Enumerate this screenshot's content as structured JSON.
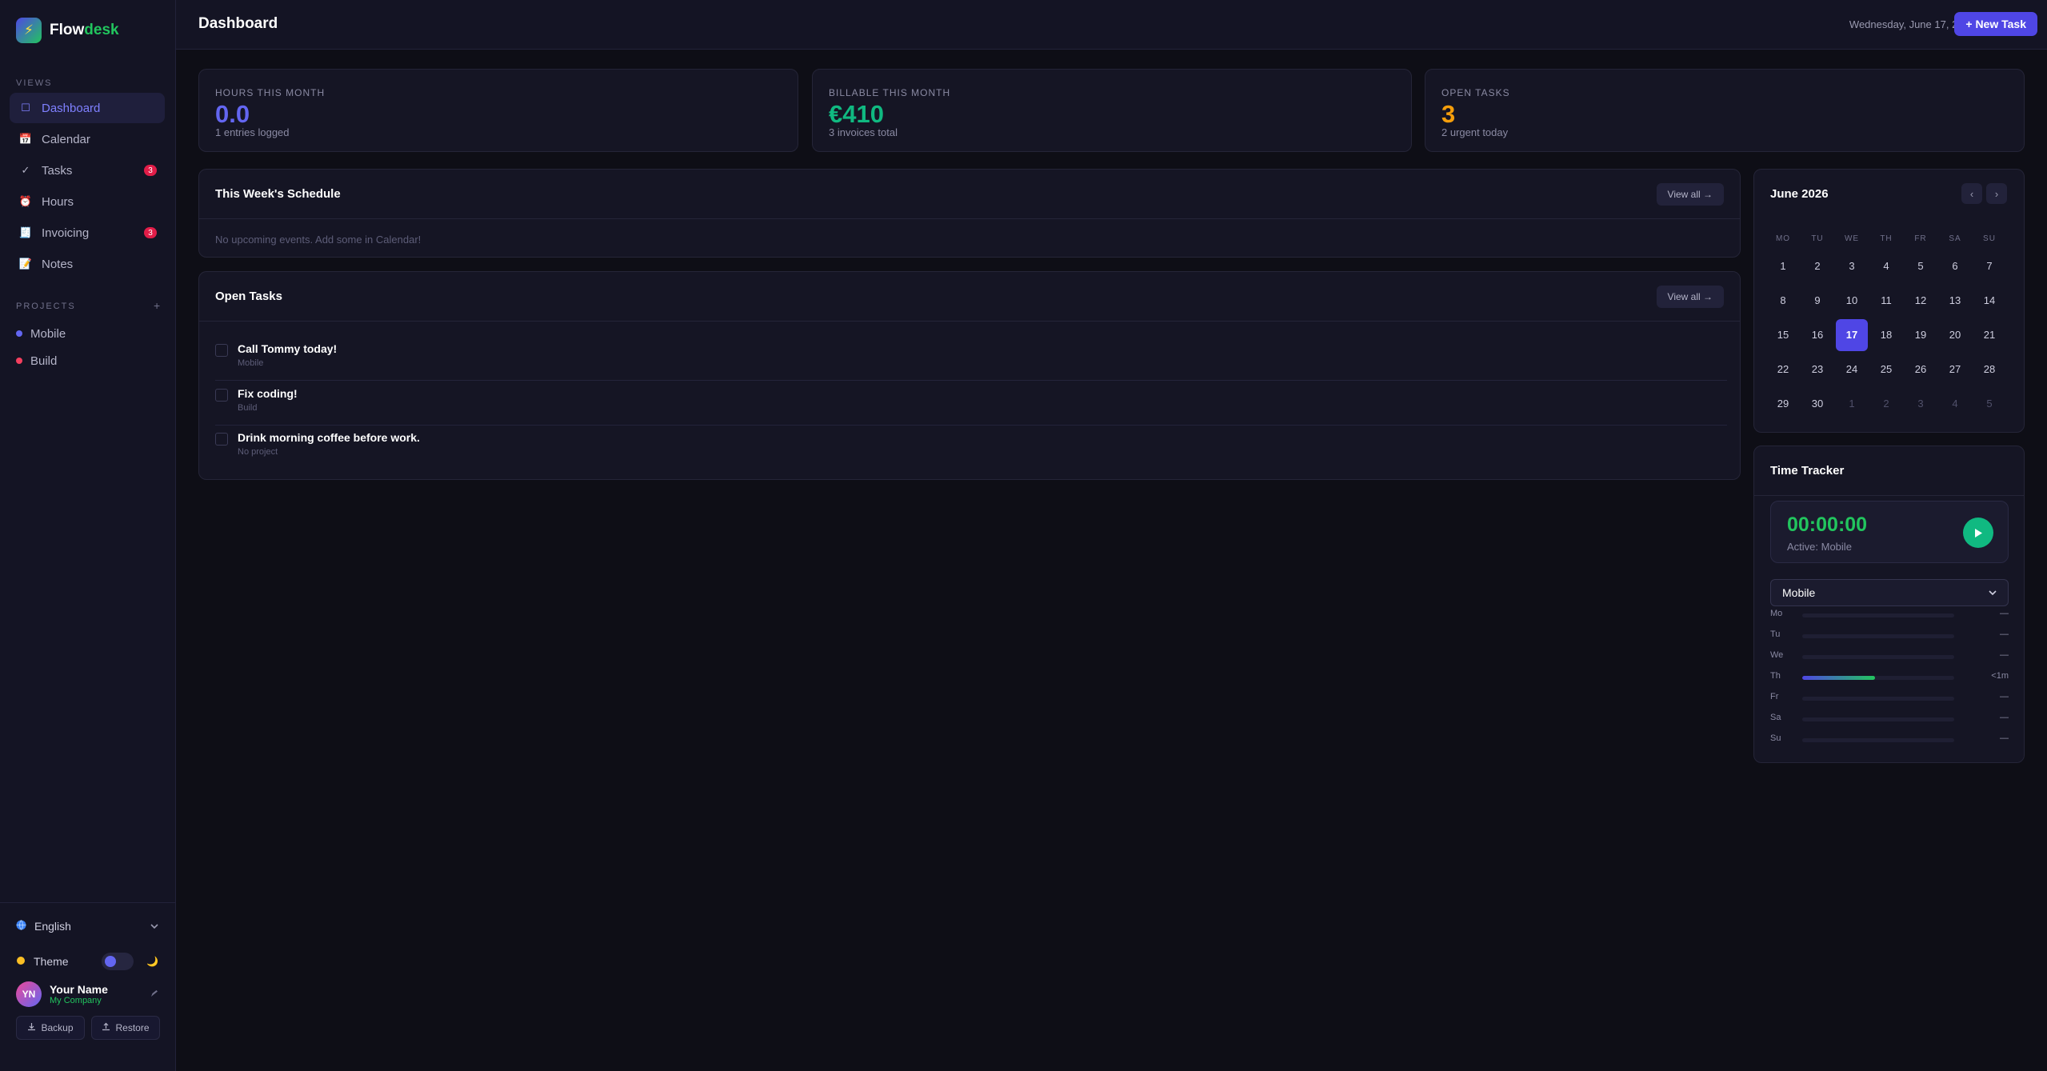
{
  "app": {
    "name_main": "Flow",
    "name_accent": "desk",
    "logo_glyph": "⚡"
  },
  "sidebar": {
    "views_label": "VIEWS",
    "items": [
      {
        "label": "Dashboard",
        "icon": "☐",
        "badge": ""
      },
      {
        "label": "Calendar",
        "icon": "📅",
        "badge": ""
      },
      {
        "label": "Tasks",
        "icon": "✓",
        "badge": "3"
      },
      {
        "label": "Hours",
        "icon": "⏰",
        "badge": ""
      },
      {
        "label": "Invoicing",
        "icon": "🧾",
        "badge": "3"
      },
      {
        "label": "Notes",
        "icon": "📝",
        "badge": ""
      }
    ],
    "projects_label": "PROJECTS",
    "projects_add": "+",
    "projects": [
      {
        "label": "Mobile",
        "color": "#6366f1"
      },
      {
        "label": "Build",
        "color": "#f43f5e"
      }
    ],
    "language": "English",
    "theme_label": "Theme",
    "theme_moon": "🌙",
    "user": {
      "initials": "YN",
      "name": "Your Name",
      "company": "My Company"
    },
    "backup_label": "Backup",
    "restore_label": "Restore"
  },
  "header": {
    "title": "Dashboard",
    "date": "Wednesday, June 17, 2026",
    "new_task_label": "+ New Task"
  },
  "stats": [
    {
      "label": "HOURS THIS MONTH",
      "value": "0.0",
      "sub": "1 entries logged",
      "color": "#6366f1"
    },
    {
      "label": "BILLABLE THIS MONTH",
      "value": "€410",
      "sub": "3 invoices total",
      "color": "#10b981"
    },
    {
      "label": "OPEN TASKS",
      "value": "3",
      "sub": "2 urgent today",
      "color": "#f59e0b"
    }
  ],
  "schedule": {
    "title": "This Week's Schedule",
    "view_all": "View all →",
    "empty": "No upcoming events. Add some in Calendar!"
  },
  "open_tasks": {
    "title": "Open Tasks",
    "view_all": "View all →",
    "items": [
      {
        "title": "Call Tommy today!",
        "project": "Mobile"
      },
      {
        "title": "Fix coding!",
        "project": "Build"
      },
      {
        "title": "Drink morning coffee before work.",
        "project": "No project"
      }
    ]
  },
  "calendar": {
    "title": "June 2026",
    "prev": "‹",
    "next": "›",
    "dow": [
      "MO",
      "TU",
      "WE",
      "TH",
      "FR",
      "SA",
      "SU"
    ],
    "weeks": [
      [
        "1",
        "2",
        "3",
        "4",
        "5",
        "6",
        "7"
      ],
      [
        "8",
        "9",
        "10",
        "11",
        "12",
        "13",
        "14"
      ],
      [
        "15",
        "16",
        "17",
        "18",
        "19",
        "20",
        "21"
      ],
      [
        "22",
        "23",
        "24",
        "25",
        "26",
        "27",
        "28"
      ],
      [
        "29",
        "30",
        "1",
        "2",
        "3",
        "4",
        "5"
      ]
    ],
    "today": "17"
  },
  "time_tracker": {
    "title": "Time Tracker",
    "time": "00:00:00",
    "active": "Active: Mobile",
    "project_select": "Mobile",
    "days": [
      {
        "day": "Mo",
        "value": "—",
        "fill": 0
      },
      {
        "day": "Tu",
        "value": "—",
        "fill": 0
      },
      {
        "day": "We",
        "value": "—",
        "fill": 0
      },
      {
        "day": "Th",
        "value": "<1m",
        "fill": 0.48
      },
      {
        "day": "Fr",
        "value": "—",
        "fill": 0
      },
      {
        "day": "Sa",
        "value": "—",
        "fill": 0
      },
      {
        "day": "Su",
        "value": "—",
        "fill": 0
      }
    ]
  }
}
